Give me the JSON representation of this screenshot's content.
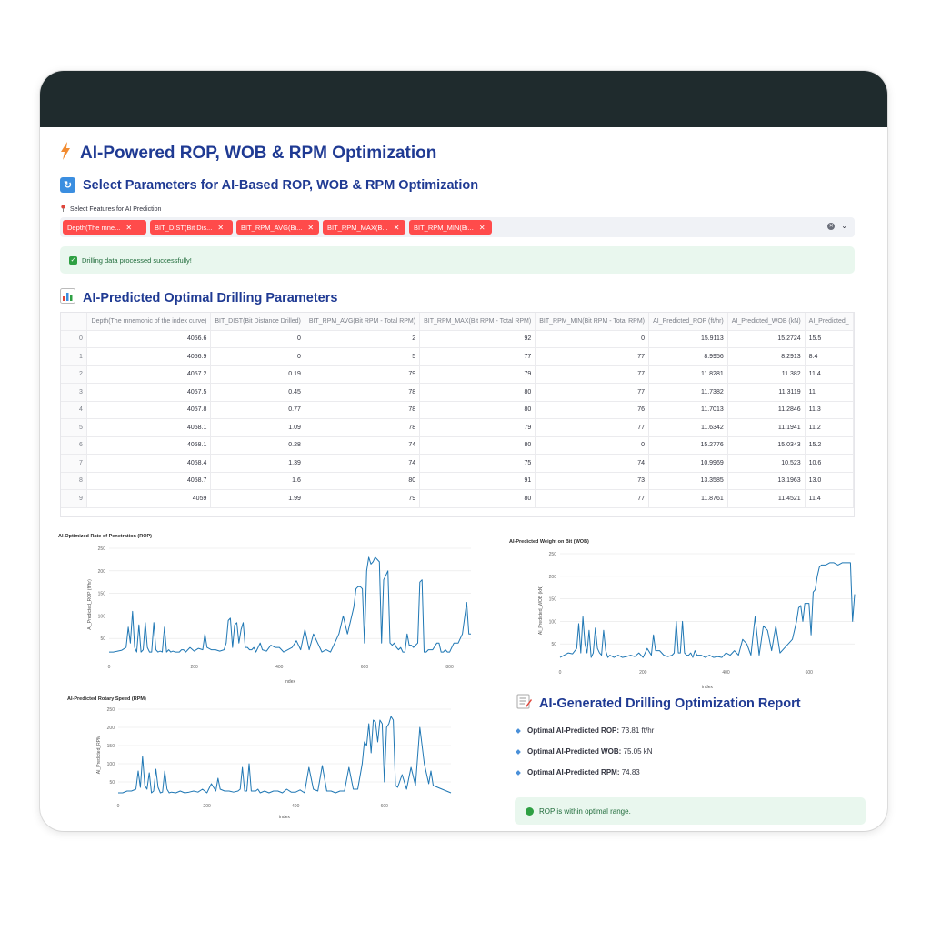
{
  "header": {
    "title": "AI-Powered ROP, WOB & RPM Optimization"
  },
  "params_section": {
    "heading": "Select Parameters for AI-Based ROP, WOB & RPM Optimization",
    "select_label": "Select Features for AI Prediction",
    "chips": [
      "Depth(The mne...",
      "BIT_DIST(Bit Dis...",
      "BIT_RPM_AVG(Bi...",
      "BIT_RPM_MAX(B...",
      "BIT_RPM_MIN(Bi..."
    ],
    "success_message": "Drilling data processed successfully!"
  },
  "table_section": {
    "heading": "AI-Predicted Optimal Drilling Parameters",
    "columns": [
      "",
      "Depth(The mnemonic of the index curve)",
      "BIT_DIST(Bit Distance Drilled)",
      "BIT_RPM_AVG(Bit RPM - Total RPM)",
      "BIT_RPM_MAX(Bit RPM - Total RPM)",
      "BIT_RPM_MIN(Bit RPM - Total RPM)",
      "AI_Predicted_ROP (ft/hr)",
      "AI_Predicted_WOB (kN)",
      "AI_Predicted_"
    ],
    "rows": [
      [
        "0",
        "4056.6",
        "0",
        "2",
        "92",
        "0",
        "15.9113",
        "15.2724",
        "15.5"
      ],
      [
        "1",
        "4056.9",
        "0",
        "5",
        "77",
        "77",
        "8.9956",
        "8.2913",
        "8.4"
      ],
      [
        "2",
        "4057.2",
        "0.19",
        "79",
        "79",
        "77",
        "11.8281",
        "11.382",
        "11.4"
      ],
      [
        "3",
        "4057.5",
        "0.45",
        "78",
        "80",
        "77",
        "11.7382",
        "11.3119",
        "11"
      ],
      [
        "4",
        "4057.8",
        "0.77",
        "78",
        "80",
        "76",
        "11.7013",
        "11.2846",
        "11.3"
      ],
      [
        "5",
        "4058.1",
        "1.09",
        "78",
        "79",
        "77",
        "11.6342",
        "11.1941",
        "11.2"
      ],
      [
        "6",
        "4058.1",
        "0.28",
        "74",
        "80",
        "0",
        "15.2776",
        "15.0343",
        "15.2"
      ],
      [
        "7",
        "4058.4",
        "1.39",
        "74",
        "75",
        "74",
        "10.9969",
        "10.523",
        "10.6"
      ],
      [
        "8",
        "4058.7",
        "1.6",
        "80",
        "91",
        "73",
        "13.3585",
        "13.1963",
        "13.0"
      ],
      [
        "9",
        "4059",
        "1.99",
        "79",
        "80",
        "77",
        "11.8761",
        "11.4521",
        "11.4"
      ]
    ]
  },
  "chart_data": [
    {
      "type": "line",
      "title": "AI-Optimized Rate of Penetration (ROP)",
      "xlabel": "index",
      "ylabel": "AI_Predicted_ROP (ft/hr)",
      "xlim": [
        0,
        850
      ],
      "ylim": [
        0,
        250
      ],
      "xticks": [
        0,
        200,
        400,
        600,
        800
      ],
      "yticks": [
        50,
        100,
        150,
        200,
        250
      ],
      "color": "#1f77b4",
      "x": [
        0,
        10,
        20,
        30,
        40,
        45,
        50,
        55,
        60,
        65,
        70,
        75,
        80,
        85,
        90,
        95,
        100,
        105,
        110,
        115,
        120,
        125,
        130,
        135,
        140,
        145,
        150,
        155,
        160,
        165,
        170,
        175,
        180,
        190,
        200,
        210,
        220,
        225,
        230,
        240,
        250,
        260,
        270,
        275,
        280,
        285,
        290,
        295,
        300,
        305,
        310,
        315,
        320,
        325,
        330,
        335,
        340,
        345,
        350,
        355,
        360,
        370,
        380,
        390,
        400,
        410,
        420,
        430,
        440,
        450,
        460,
        470,
        480,
        490,
        500,
        510,
        520,
        530,
        540,
        550,
        560,
        570,
        575,
        580,
        585,
        590,
        595,
        600,
        605,
        610,
        615,
        620,
        625,
        630,
        635,
        640,
        645,
        650,
        655,
        660,
        665,
        670,
        675,
        680,
        685,
        690,
        695,
        700,
        705,
        710,
        715,
        720,
        725,
        730,
        735,
        740,
        745,
        750,
        760,
        770,
        775,
        780,
        785,
        790,
        795,
        800,
        805,
        810,
        820,
        830,
        840,
        845,
        850
      ],
      "y": [
        20,
        20,
        22,
        24,
        30,
        75,
        40,
        110,
        30,
        20,
        80,
        20,
        25,
        85,
        30,
        20,
        20,
        85,
        25,
        20,
        22,
        20,
        75,
        20,
        25,
        20,
        22,
        20,
        20,
        20,
        25,
        25,
        20,
        30,
        22,
        28,
        25,
        60,
        30,
        25,
        25,
        22,
        25,
        40,
        90,
        95,
        30,
        80,
        85,
        40,
        70,
        85,
        30,
        30,
        25,
        25,
        30,
        20,
        30,
        40,
        25,
        22,
        35,
        30,
        30,
        20,
        25,
        30,
        45,
        25,
        70,
        25,
        60,
        40,
        20,
        25,
        20,
        40,
        60,
        100,
        60,
        100,
        120,
        160,
        165,
        165,
        160,
        40,
        200,
        230,
        215,
        220,
        230,
        225,
        220,
        40,
        180,
        190,
        200,
        40,
        35,
        40,
        30,
        25,
        30,
        20,
        20,
        60,
        35,
        35,
        30,
        35,
        40,
        175,
        180,
        20,
        20,
        25,
        25,
        40,
        40,
        20,
        20,
        25,
        20,
        20,
        30,
        40,
        40,
        60,
        130,
        60,
        60
      ]
    },
    {
      "type": "line",
      "title": "AI-Predicted Weight on Bit (WOB)",
      "xlabel": "index",
      "ylabel": "AI_Predicted_WOB (kN)",
      "xlim": [
        0,
        710
      ],
      "ylim": [
        0,
        250
      ],
      "xticks": [
        0,
        200,
        400,
        600
      ],
      "yticks": [
        50,
        100,
        150,
        200,
        250
      ],
      "color": "#1f77b4",
      "x": [
        0,
        10,
        20,
        30,
        40,
        45,
        50,
        55,
        60,
        65,
        70,
        75,
        80,
        85,
        90,
        95,
        100,
        105,
        110,
        115,
        120,
        130,
        140,
        150,
        160,
        170,
        180,
        190,
        200,
        210,
        220,
        225,
        230,
        240,
        250,
        260,
        270,
        275,
        280,
        285,
        290,
        295,
        300,
        305,
        310,
        315,
        320,
        325,
        330,
        340,
        350,
        360,
        370,
        380,
        390,
        400,
        410,
        420,
        430,
        440,
        450,
        460,
        470,
        480,
        490,
        500,
        510,
        520,
        530,
        540,
        550,
        560,
        570,
        575,
        580,
        585,
        590,
        595,
        600,
        605,
        610,
        615,
        620,
        625,
        630,
        640,
        650,
        660,
        670,
        680,
        690,
        700,
        705,
        710
      ],
      "y": [
        20,
        25,
        30,
        28,
        40,
        95,
        30,
        110,
        50,
        30,
        80,
        20,
        30,
        85,
        40,
        30,
        25,
        80,
        35,
        20,
        25,
        20,
        25,
        20,
        22,
        25,
        22,
        30,
        20,
        40,
        25,
        70,
        35,
        35,
        25,
        22,
        25,
        30,
        100,
        30,
        30,
        100,
        30,
        25,
        25,
        30,
        20,
        35,
        25,
        25,
        20,
        25,
        20,
        22,
        20,
        30,
        25,
        35,
        25,
        60,
        50,
        25,
        110,
        25,
        90,
        80,
        35,
        90,
        30,
        40,
        50,
        60,
        100,
        130,
        135,
        100,
        140,
        140,
        140,
        70,
        165,
        170,
        200,
        220,
        225,
        225,
        230,
        230,
        225,
        230,
        230,
        230,
        100,
        160
      ]
    },
    {
      "type": "line",
      "title": "AI-Predicted Rotary Speed (RPM)",
      "xlabel": "index",
      "ylabel": "AI_Predicted_RPM",
      "xlim": [
        0,
        750
      ],
      "ylim": [
        0,
        250
      ],
      "xticks": [
        0,
        200,
        400,
        600
      ],
      "yticks": [
        50,
        100,
        150,
        200,
        250
      ],
      "color": "#1f77b4",
      "x": [
        0,
        10,
        20,
        30,
        40,
        45,
        50,
        55,
        60,
        65,
        70,
        75,
        80,
        85,
        90,
        95,
        100,
        105,
        110,
        115,
        120,
        130,
        140,
        150,
        160,
        170,
        180,
        190,
        200,
        210,
        220,
        225,
        230,
        240,
        250,
        260,
        270,
        275,
        280,
        285,
        290,
        295,
        300,
        305,
        310,
        315,
        320,
        330,
        340,
        350,
        360,
        370,
        380,
        390,
        400,
        410,
        420,
        430,
        440,
        450,
        460,
        470,
        480,
        490,
        500,
        510,
        520,
        530,
        540,
        550,
        555,
        560,
        565,
        570,
        575,
        580,
        585,
        590,
        595,
        600,
        605,
        610,
        615,
        620,
        625,
        630,
        640,
        650,
        660,
        670,
        680,
        690,
        700,
        705,
        710,
        720,
        730,
        740,
        750
      ],
      "y": [
        20,
        20,
        25,
        25,
        30,
        80,
        35,
        120,
        40,
        30,
        75,
        20,
        25,
        85,
        35,
        20,
        22,
        80,
        30,
        20,
        22,
        20,
        25,
        20,
        22,
        25,
        22,
        30,
        20,
        45,
        25,
        60,
        30,
        25,
        25,
        22,
        25,
        30,
        90,
        25,
        25,
        100,
        25,
        25,
        25,
        30,
        20,
        25,
        20,
        25,
        25,
        20,
        30,
        22,
        22,
        28,
        20,
        90,
        30,
        25,
        95,
        25,
        25,
        20,
        25,
        25,
        90,
        30,
        30,
        100,
        160,
        150,
        210,
        130,
        220,
        215,
        160,
        220,
        210,
        50,
        200,
        210,
        230,
        220,
        40,
        35,
        70,
        30,
        90,
        40,
        200,
        100,
        45,
        80,
        40,
        35,
        30,
        25,
        20
      ]
    }
  ],
  "report": {
    "heading": "AI-Generated Drilling Optimization Report",
    "items": [
      {
        "label": "Optimal AI-Predicted ROP:",
        "value": "73.81 ft/hr"
      },
      {
        "label": "Optimal AI-Predicted WOB:",
        "value": "75.05 kN"
      },
      {
        "label": "Optimal AI-Predicted RPM:",
        "value": "74.83"
      }
    ],
    "status": "ROP is within optimal range."
  },
  "colors": {
    "heading": "#1f3a93",
    "chip": "#ff4b4b",
    "success_bg": "#e9f7ee",
    "line": "#1f77b4",
    "frame_header": "#1f2b2d"
  },
  "icons": {
    "title": "lightning-icon",
    "params": "refresh-icon",
    "table": "bar-chart-icon",
    "report": "memo-icon",
    "pin": "pin-icon",
    "success": "checkmark-icon",
    "status": "green-circle-icon"
  }
}
